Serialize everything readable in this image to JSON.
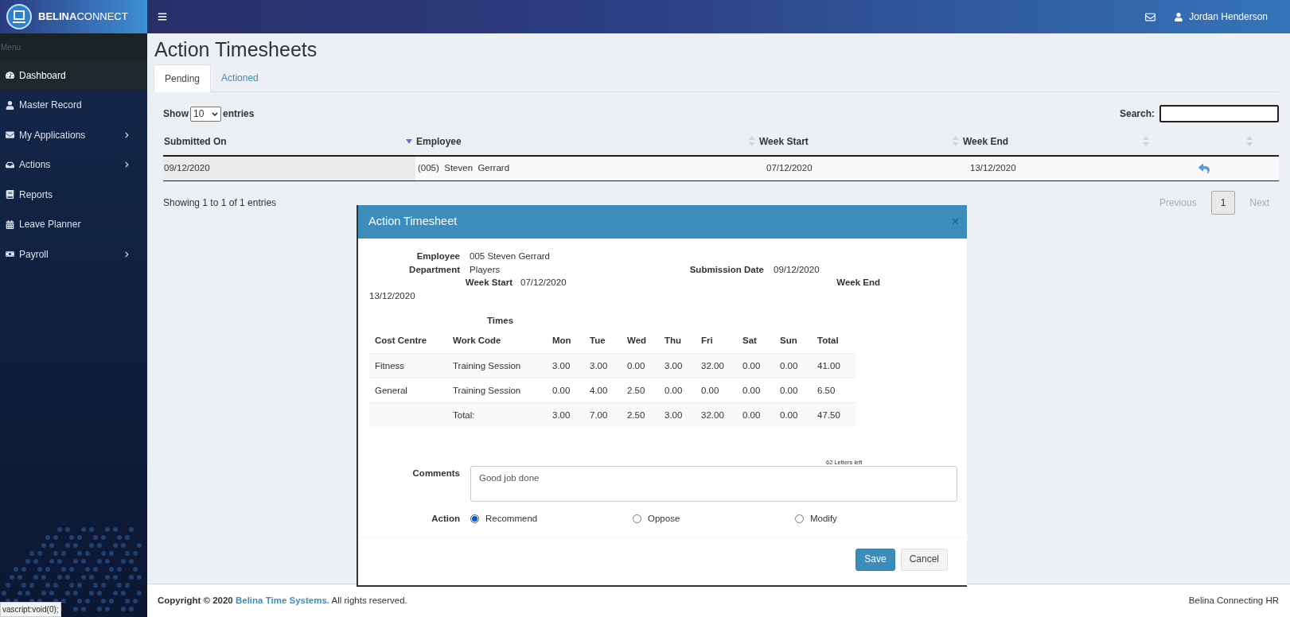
{
  "header": {
    "brand_bold": "BELINA",
    "brand_light": "CONNECT",
    "user": "Jordan Henderson"
  },
  "sidebar": {
    "label": "Menu",
    "items": [
      {
        "label": "Dashboard",
        "selected": true,
        "has_children": false
      },
      {
        "label": "Master Record",
        "selected": false,
        "has_children": false
      },
      {
        "label": "My Applications",
        "selected": false,
        "has_children": true
      },
      {
        "label": "Actions",
        "selected": false,
        "has_children": true
      },
      {
        "label": "Reports",
        "selected": false,
        "has_children": false
      },
      {
        "label": "Leave Planner",
        "selected": false,
        "has_children": false
      },
      {
        "label": "Payroll",
        "selected": false,
        "has_children": true
      }
    ]
  },
  "page": {
    "title": "Action Timesheets",
    "tabs": [
      {
        "label": "Pending",
        "selected": true
      },
      {
        "label": "Actioned",
        "selected": false
      }
    ],
    "show_label": "Show",
    "page_length": "10",
    "entries_label": "entries",
    "search_label": "Search:",
    "table": {
      "columns": [
        {
          "label": "Submitted On",
          "sorted": true
        },
        {
          "label": "Employee",
          "sorted": false
        },
        {
          "label": "Week Start",
          "sorted": false
        },
        {
          "label": "Week End",
          "sorted": false
        },
        {
          "sorted": false
        }
      ],
      "rows": [
        {
          "submitted_on": "09/12/2020",
          "employee": "(005)  Steven  Gerrard",
          "week_start": "07/12/2020",
          "week_end": "13/12/2020"
        }
      ]
    },
    "info": "Showing 1 to 1 of 1 entries",
    "pagination": [
      {
        "label": "Previous",
        "kind": "nav",
        "selected": false,
        "disabled": true
      },
      {
        "label": "1",
        "kind": "page",
        "selected": true,
        "disabled": false
      },
      {
        "label": "Next",
        "kind": "nav",
        "selected": false,
        "disabled": true
      }
    ]
  },
  "modal": {
    "title": "Action Timesheet",
    "close": "×",
    "employee_label": "Employee",
    "employee": "005 Steven Gerrard",
    "department_label": "Department",
    "department": "Players",
    "submission_label": "Submission Date",
    "submission": "09/12/2020",
    "week_start_label": "Week Start",
    "week_start": "07/12/2020",
    "week_end_label": "Week End",
    "week_end": "13/12/2020",
    "times_label": "Times",
    "columns": [
      "Cost Centre",
      "Work Code",
      "Mon",
      "Tue",
      "Wed",
      "Thu",
      "Fri",
      "Sat",
      "Sun",
      "Total"
    ],
    "rows": [
      [
        "Fitness",
        "Training Session",
        "3.00",
        "3.00",
        "0.00",
        "3.00",
        "32.00",
        "0.00",
        "0.00",
        "41.00"
      ],
      [
        "General",
        "Training Session",
        "0.00",
        "4.00",
        "2.50",
        "0.00",
        "0.00",
        "0.00",
        "0.00",
        "6.50"
      ],
      [
        "",
        "Total:",
        "3.00",
        "7.00",
        "2.50",
        "3.00",
        "32.00",
        "0.00",
        "0.00",
        "47.50"
      ]
    ],
    "letters_left": "62 Letters left",
    "comments_label": "Comments",
    "comments": "Good job done",
    "action_label": "Action",
    "options": [
      {
        "label": "Recommend",
        "selected": true
      },
      {
        "label": "Oppose",
        "selected": false
      },
      {
        "label": "Modify",
        "selected": false
      }
    ],
    "buttons": [
      {
        "label": "Save",
        "kind": "primary"
      },
      {
        "label": "Cancel",
        "kind": "default"
      }
    ]
  },
  "footer": {
    "copyright": "Copyright © 2020",
    "link": "Belina Time Systems.",
    "rest": " All rights reserved.",
    "right": "Belina Connecting HR"
  },
  "status_tip": "vascript:void(0);"
}
